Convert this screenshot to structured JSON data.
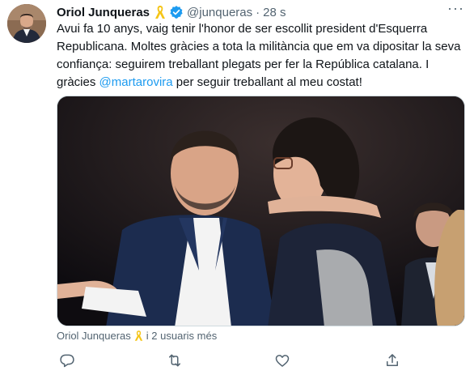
{
  "tweet": {
    "author_name": "Oriol Junqueras",
    "handle": "@junqueras",
    "separator": "·",
    "timestamp": "28 s",
    "more_label": "···",
    "text_before_mention": "Avui fa 10 anys, vaig tenir l'honor de ser escollit president d'Esquerra Republicana. Moltes gràcies a tota la militància que em va dipositar la seva confiança: seguirem treballant plegats per fer la República catalana. I gràcies ",
    "mention": "@martarovira",
    "text_after_mention": " per seguir treballant al meu costat!",
    "tagged_name": "Oriol Junqueras",
    "tagged_others": "i 2 usuaris més"
  },
  "icons": {
    "avatar": "avatar-photo",
    "ribbon": "yellow-ribbon-icon",
    "verified": "verified-badge-icon",
    "reply": "reply-icon",
    "retweet": "retweet-icon",
    "like": "heart-icon",
    "share": "share-icon"
  },
  "colors": {
    "accent": "#1d9bf0",
    "secondary_text": "#536471",
    "ribbon": "#f5c518"
  }
}
